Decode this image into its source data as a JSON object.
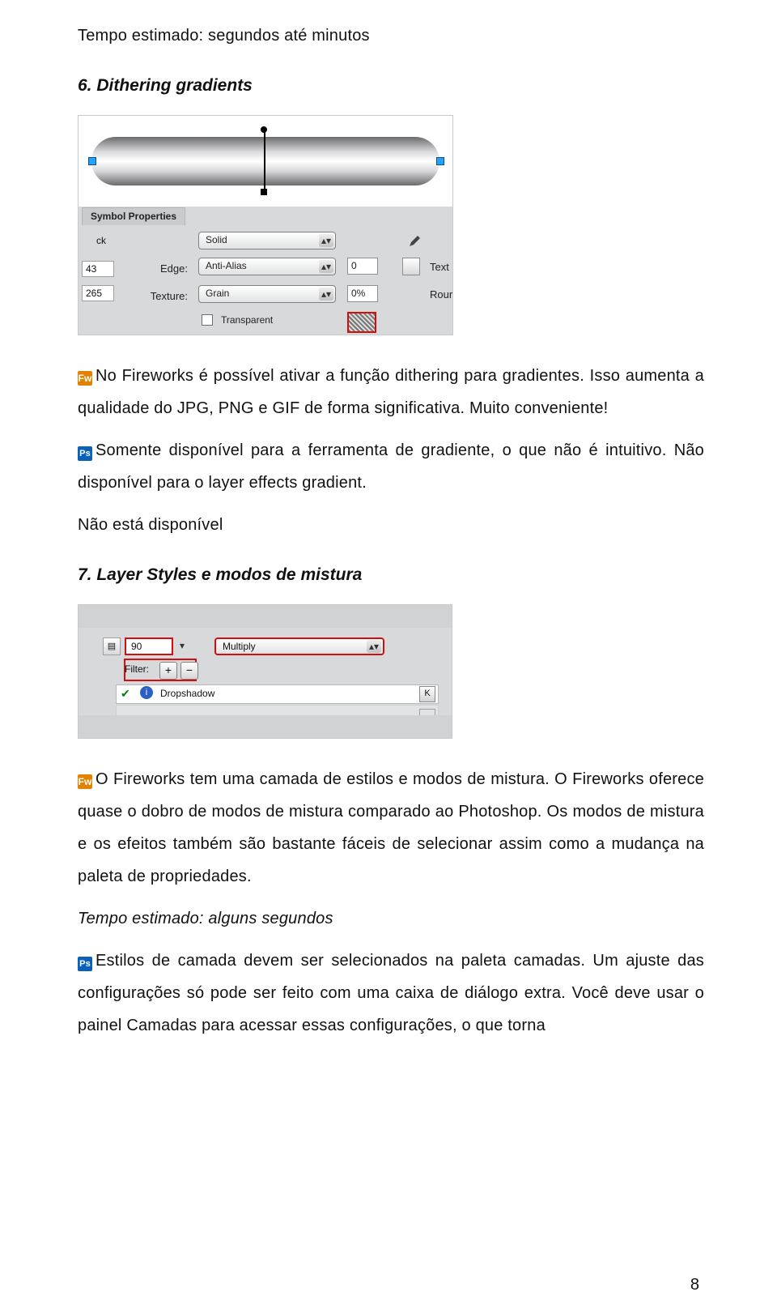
{
  "intro_line": "Tempo estimado: segundos até minutos",
  "sec6": {
    "title": "6. Dithering gradients",
    "fw": "No Fireworks é possível ativar a função dithering para gradientes. Isso aumenta a qualidade do JPG, PNG e GIF de forma significativa. Muito conveniente!",
    "ps": "Somente disponível para a ferramenta de gradiente, o que não é intuitivo. Não disponível para o layer effects gradient.",
    "neutral": "Não está disponível"
  },
  "sec7": {
    "title": "7. Layer Styles e modos de mistura",
    "fw": "O Fireworks tem uma camada de estilos e modos de mistura. O Fireworks oferece quase o dobro de modos de mistura comparado ao Photoshop. Os modos de mistura e os efeitos também são bastante fáceis de selecionar assim como a mudança na paleta de propriedades.",
    "tempo": "Tempo estimado: alguns segundos",
    "ps": "Estilos de camada devem ser selecionados na paleta camadas. Um ajuste das configurações só pode ser feito com uma caixa de diálogo extra. Você deve usar o painel Camadas para acessar essas configurações, o que torna"
  },
  "icons": {
    "fw": "Fw",
    "ps": "Ps"
  },
  "ss1": {
    "tab": "Symbol Properties",
    "row_ck": "ck",
    "edge_label": "Edge:",
    "edge_value": "Anti-Alias",
    "edge_num": "0",
    "fill_value": "Solid",
    "tex_label": "Texture:",
    "tex_value": "Grain",
    "tex_percent": "0%",
    "text_hint": "Text",
    "rour_hint": "Rour",
    "left_43": "43",
    "left_265": "265",
    "transparent": "Transparent"
  },
  "ss2": {
    "opacity": "90",
    "blend": "Multiply",
    "filter_label": "Filter:",
    "plus": "+",
    "minus": "−",
    "row_text": "Dropshadow",
    "k": "K"
  },
  "page_number": "8"
}
